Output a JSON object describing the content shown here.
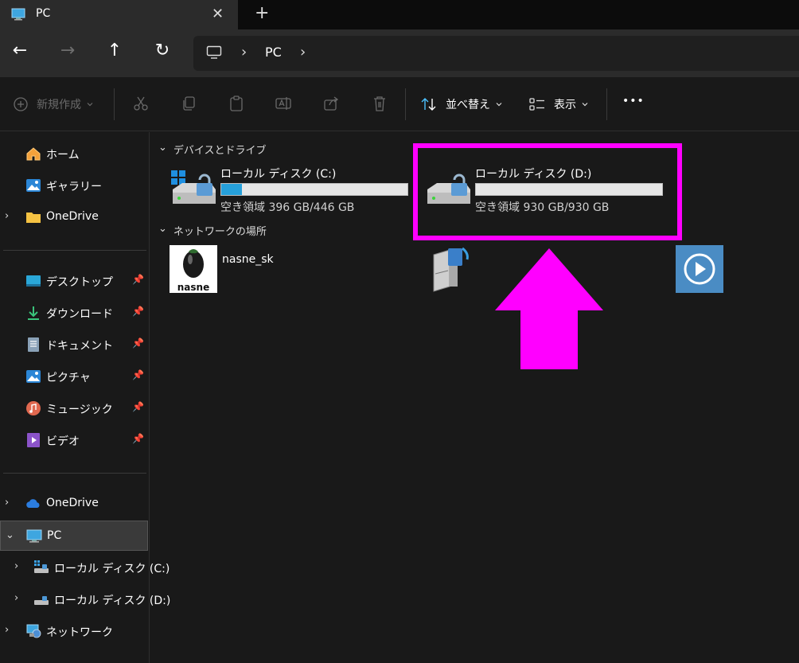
{
  "tab": {
    "title": "PC",
    "close_glyph": "✕",
    "new_tab_glyph": "+"
  },
  "nav": {
    "back_glyph": "←",
    "forward_glyph": "→",
    "up_glyph": "↑",
    "refresh_glyph": "↻",
    "breadcrumb_sep": "›",
    "breadcrumb": "PC"
  },
  "toolbar": {
    "new_label": "新規作成",
    "sort_label": "並べ替え",
    "view_label": "表示",
    "more_label": "•••"
  },
  "sidebar": {
    "home": "ホーム",
    "gallery": "ギャラリー",
    "onedrive1": "OneDrive",
    "desktop": "デスクトップ",
    "downloads": "ダウンロード",
    "documents": "ドキュメント",
    "pictures": "ピクチャ",
    "music": "ミュージック",
    "videos": "ビデオ",
    "onedrive2": "OneDrive",
    "pc": "PC",
    "disk_c": "ローカル ディスク (C:)",
    "disk_d": "ローカル ディスク (D:)",
    "network": "ネットワーク"
  },
  "main": {
    "group_devices": "デバイスとドライブ",
    "group_network": "ネットワークの場所",
    "drive_c": {
      "name": "ローカル ディスク (C:)",
      "free": "空き領域 396 GB/446 GB",
      "used_fraction": 0.11
    },
    "drive_d": {
      "name": "ローカル ディスク (D:)",
      "free": "空き領域 930 GB/930 GB",
      "used_fraction": 0.0
    },
    "network_item": "nasne_sk",
    "nasne_logo_text": "nasne"
  },
  "colors": {
    "highlight": "#ff00ff",
    "drive_fill": "#26a0da",
    "accent": "#4cc2ff"
  }
}
